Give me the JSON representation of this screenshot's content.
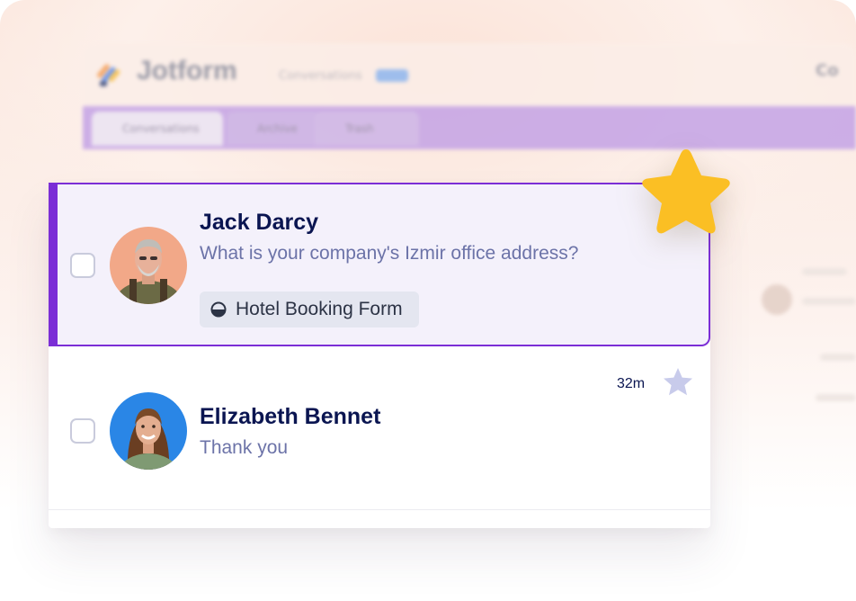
{
  "background_app": {
    "logo_text": "Jotform",
    "nav_label": "Conversations",
    "top_right_text": "Co",
    "tabs": [
      "Conversations",
      "Archive",
      "Trash"
    ]
  },
  "conversations": [
    {
      "name": "Jack Darcy",
      "message": "What is your company's Izmir office address?",
      "form_tag": "Hotel Booking Form",
      "selected": true,
      "starred": true
    },
    {
      "name": "Elizabeth Bennet",
      "message": "Thank you",
      "time": "32m",
      "selected": false,
      "starred": false
    }
  ],
  "colors": {
    "accent": "#7b2ed6",
    "name_text": "#0a1551",
    "message_text": "#6c73a8",
    "star_active": "#fbbf24",
    "star_inactive": "#c8cbeb"
  },
  "icons": {
    "star_big": "star-icon",
    "star_row": "star-outline-icon",
    "form_tag": "half-circle-icon"
  }
}
